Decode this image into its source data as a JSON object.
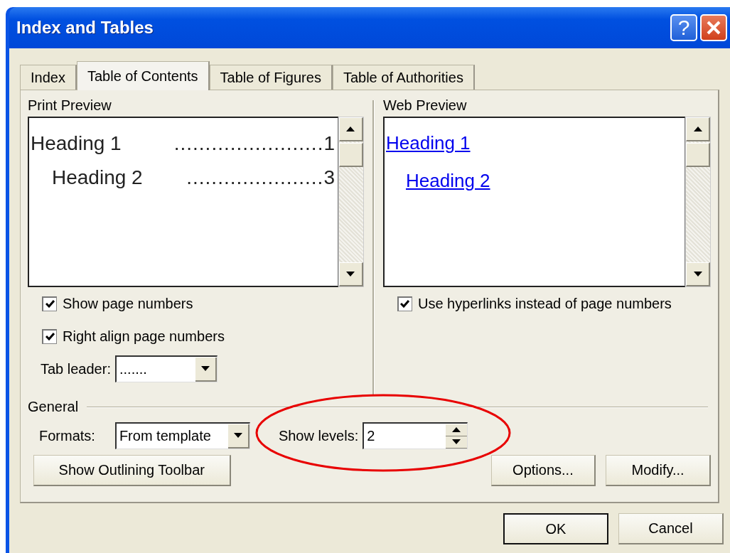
{
  "window": {
    "title": "Index and Tables"
  },
  "title_buttons": [
    {
      "kind": "help",
      "label": "?"
    },
    {
      "kind": "close"
    }
  ],
  "tabs": [
    {
      "label": "Index",
      "selected": false
    },
    {
      "label": "Table of Contents",
      "selected": true
    },
    {
      "label": "Table of Figures",
      "selected": false
    },
    {
      "label": "Table of Authorities",
      "selected": false
    }
  ],
  "print_preview": {
    "label": "Print Preview",
    "entries": [
      {
        "text": "Heading 1",
        "leader": "........................",
        "page": "1",
        "children": [
          {
            "text": "Heading 2",
            "leader": "......................",
            "page": "3"
          }
        ]
      }
    ]
  },
  "web_preview": {
    "label": "Web Preview",
    "links": [
      {
        "text": "Heading 1",
        "children": [
          {
            "text": "Heading 2"
          }
        ]
      }
    ]
  },
  "print_options": [
    {
      "label": "Show page numbers",
      "checked": true
    },
    {
      "label": "Right align page numbers",
      "checked": true
    }
  ],
  "tab_leader": {
    "label": "Tab leader:",
    "value": "......."
  },
  "web_options": [
    {
      "label": "Use hyperlinks instead of page numbers",
      "checked": true
    }
  ],
  "general": {
    "label": "General",
    "formats": {
      "label": "Formats:",
      "value": "From template"
    },
    "show_levels": {
      "label": "Show levels:",
      "value": "2"
    }
  },
  "panel_buttons": [
    "Show Outlining Toolbar",
    "Options...",
    "Modify..."
  ],
  "dialog_buttons": [
    {
      "label": "OK",
      "default": true
    },
    {
      "label": "Cancel",
      "default": false
    }
  ],
  "annotation": {
    "kind": "ellipse"
  }
}
